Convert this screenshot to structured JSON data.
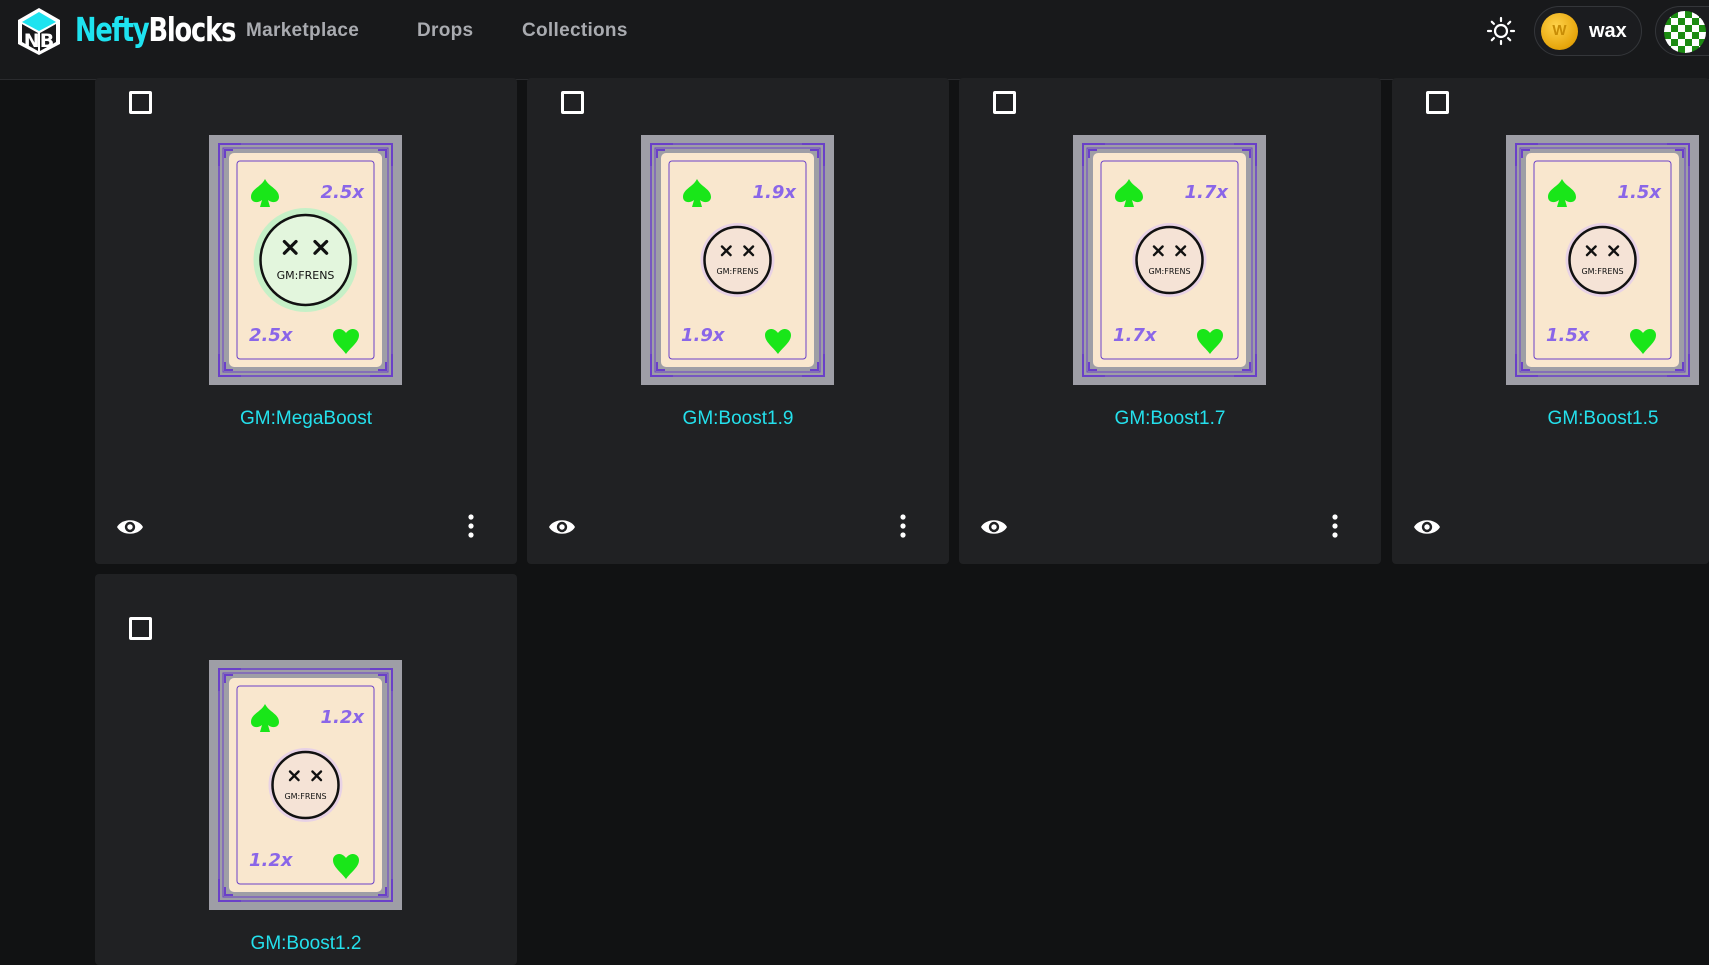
{
  "header": {
    "brand_part1": "Nefty",
    "brand_part2": "Blocks",
    "logo_letters": "NB",
    "nav": [
      "Marketplace",
      "Drops",
      "Collections"
    ],
    "wallet_label": "wax",
    "wallet_coin_glyph": "W"
  },
  "cards": [
    {
      "name": "GM:MegaBoost",
      "multiplier": "2.5x",
      "glow": true
    },
    {
      "name": "GM:Boost1.9",
      "multiplier": "1.9x",
      "glow": false
    },
    {
      "name": "GM:Boost1.7",
      "multiplier": "1.7x",
      "glow": false
    },
    {
      "name": "GM:Boost1.5",
      "multiplier": "1.5x",
      "glow": false
    },
    {
      "name": "GM:Boost1.2",
      "multiplier": "1.2x",
      "glow": false
    }
  ],
  "art_text": "GM:FRENS",
  "colors": {
    "accent": "#24e0ec",
    "background": "#111213",
    "card": "#202123",
    "suit_green": "#19e619",
    "multiplier_purple": "#8a66e8"
  }
}
